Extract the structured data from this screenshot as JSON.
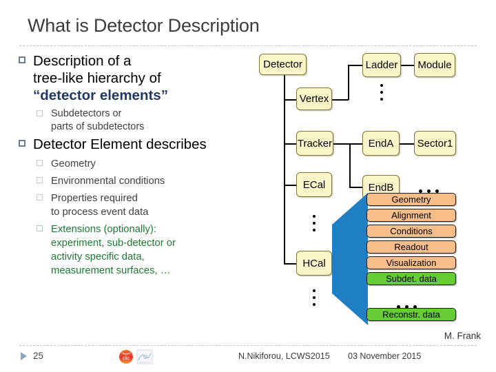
{
  "slide": {
    "title": "What is Detector Description",
    "attribution": "M. Frank"
  },
  "content": {
    "bullets": [
      {
        "text_line1": "Description of a",
        "text_line2": "tree-like hierarchy of",
        "quoted": "“detector elements”"
      }
    ],
    "sub_bullets_1": [
      {
        "line1": "Subdetectors or",
        "line2": "parts of subdetectors"
      }
    ],
    "bullet2": "Detector Element describes",
    "sub_bullets_2": [
      {
        "line1": "Geometry",
        "line2": "",
        "color": "dark"
      },
      {
        "line1": "Environmental conditions",
        "line2": "",
        "color": "dark"
      },
      {
        "line1": "Properties required",
        "line2": "to process event data",
        "color": "dark"
      },
      {
        "line1": "Extensions (optionally):",
        "line2": "experiment, sub-detector or",
        "line3": "activity specific data,",
        "line4": "measurement surfaces, …",
        "color": "green"
      }
    ]
  },
  "diagram": {
    "nodes": {
      "detector": "Detector",
      "vertex": "Vertex",
      "tracker": "Tracker",
      "ecal": "ECal",
      "hcal": "HCal",
      "ladder": "Ladder",
      "module": "Module",
      "enda": "EndA",
      "sector1": "Sector1",
      "endb": "EndB"
    },
    "attributes": [
      {
        "label": "Geometry",
        "color": "orange"
      },
      {
        "label": "Alignment",
        "color": "orange"
      },
      {
        "label": "Conditions",
        "color": "orange"
      },
      {
        "label": "Readout",
        "color": "orange"
      },
      {
        "label": "Visualization",
        "color": "orange"
      },
      {
        "label": "Subdet. data",
        "color": "green"
      },
      {
        "label": "Reconstr. data",
        "color": "green"
      }
    ],
    "colors": {
      "node_fill": "#faf5c8",
      "node_border": "#7c7536",
      "attr_orange": "#f8be8a",
      "attr_green": "#66cc33",
      "wedge_blue": "#1f7ec4"
    }
  },
  "footer": {
    "page_number": "25",
    "center_text": "N.Nikiforou, LCWS2015",
    "date": "03 November 2015",
    "logo_clic": "clic-logo",
    "logo_sketch": "institute-logo"
  }
}
